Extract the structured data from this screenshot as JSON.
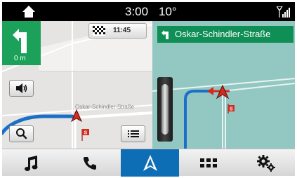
{
  "status_bar": {
    "time": "3:00",
    "temperature": "10°"
  },
  "turn_instruction": {
    "distance": "0 m"
  },
  "eta": {
    "time": "11:45"
  },
  "street_banner": {
    "name": "Oskar-Schindler-Straße"
  },
  "map": {
    "street_label": "Oskar-Schindler-Straße",
    "route_color": "#1b6fc8",
    "position_marker_color": "#d42a1f"
  },
  "nav_bar": {
    "active_tab": "navigation",
    "tabs": [
      "audio",
      "phone",
      "navigation",
      "apps",
      "settings"
    ],
    "active_color": "#0e6eb5"
  }
}
